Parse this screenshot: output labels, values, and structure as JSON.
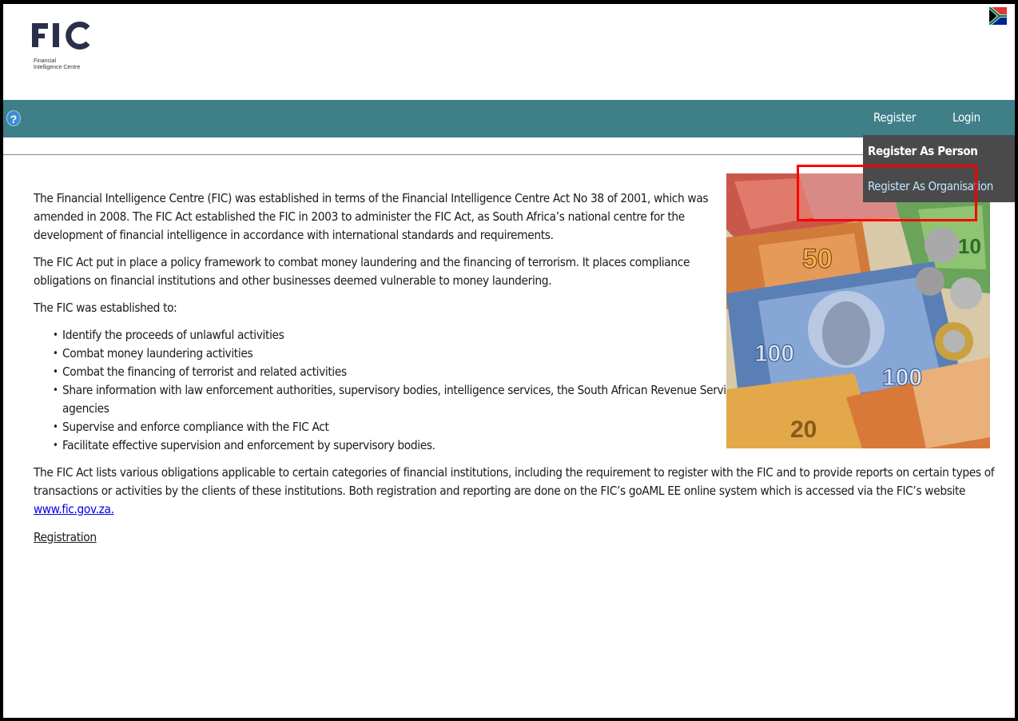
{
  "header": {
    "logo_text": "FIC",
    "logo_caption": "Financial\nIntelligence Centre",
    "flag_icon": "south-africa-flag-icon"
  },
  "nav": {
    "help_label": "?",
    "register_label": "Register",
    "login_label": "Login",
    "dropdown": {
      "person_label": "Register As Person",
      "organisation_label": "Register As Organisation"
    }
  },
  "content": {
    "intro_paragraph": "The Financial Intelligence Centre (FIC) was established in terms of the Financial Intelligence Centre Act No 38 of 2001, which was amended in 2008. The FIC Act established the FIC in 2003 to administer the FIC Act, as South Africa’s national centre for the development of financial intelligence in accordance with international standards and requirements.",
    "policy_paragraph": "The FIC Act put in place a policy framework to combat money laundering and the financing of terrorism. It places compliance obligations on financial institutions and other businesses deemed vulnerable to money laundering.",
    "established_heading": "The FIC was established to:",
    "bullets": [
      "Identify the proceeds of unlawful activities",
      "Combat money laundering activities",
      "Combat the financing of terrorist and related activities",
      "Share information with law enforcement authorities, supervisory bodies, intelligence services, the South African Revenue Service (SARS) and other local and international agencies",
      "Supervise and enforce compliance with the FIC Act",
      "Facilitate effective supervision and enforcement by supervisory bodies."
    ],
    "obligations_paragraph_lead": "The FIC Act lists various obligations applicable to certain categories of financial institutions, including the requirement to register with the FIC and to provide reports on certain types of transactions or activities by the clients of these institutions. Both registration and reporting are done on the FIC’s goAML EE online system which is accessed via the FIC’s website ",
    "website_link": "www.fic.gov.za.",
    "registration_link": "Registration"
  },
  "image": {
    "banknote_labels": [
      "50",
      "100",
      "100",
      "10",
      "20"
    ]
  },
  "colors": {
    "nav_bar": "#3e7f88",
    "dropdown_bg": "#4a4a4a",
    "highlight_box": "#ff0000",
    "link": "#0000ee"
  }
}
